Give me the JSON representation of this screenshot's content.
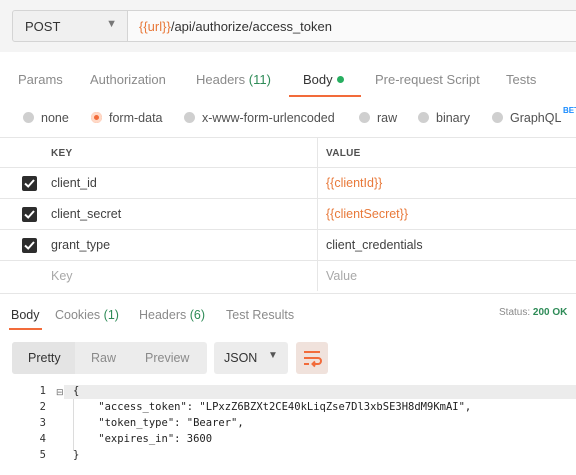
{
  "request": {
    "method": "POST",
    "url_var": "{{url}}",
    "url_path": "/api/authorize/access_token"
  },
  "tabs": {
    "params": "Params",
    "authorization": "Authorization",
    "headers": "Headers",
    "headers_count": "(11)",
    "body": "Body",
    "prerequest": "Pre-request Script",
    "tests": "Tests"
  },
  "body_types": {
    "none": "none",
    "form_data": "form-data",
    "urlencoded": "x-www-form-urlencoded",
    "raw": "raw",
    "binary": "binary",
    "graphql": "GraphQL",
    "beta": "BETA",
    "selected": "form-data"
  },
  "table": {
    "key_header": "KEY",
    "value_header": "VALUE",
    "rows": [
      {
        "key": "client_id",
        "value": "{{clientId}}",
        "checked": true
      },
      {
        "key": "client_secret",
        "value": "{{clientSecret}}",
        "checked": true
      },
      {
        "key": "grant_type",
        "value": "client_credentials",
        "checked": true
      }
    ],
    "key_placeholder": "Key",
    "value_placeholder": "Value"
  },
  "response": {
    "tabs": {
      "body": "Body",
      "cookies": "Cookies",
      "cookies_count": "(1)",
      "headers": "Headers",
      "headers_count": "(6)",
      "test_results": "Test Results"
    },
    "status_label": "Status:",
    "status_value": "200 OK",
    "view_modes": {
      "pretty": "Pretty",
      "raw": "Raw",
      "preview": "Preview"
    },
    "format": "JSON",
    "lines": [
      {
        "num": "1",
        "text": "{"
      },
      {
        "num": "2",
        "text": "    \"access_token\": \"LPxzZ6BZXt2CE40kLiqZse7Dl3xbSE3H8dM9KmAI\","
      },
      {
        "num": "3",
        "text": "    \"token_type\": \"Bearer\","
      },
      {
        "num": "4",
        "text": "    \"expires_in\": 3600"
      },
      {
        "num": "5",
        "text": "}"
      }
    ]
  },
  "colors": {
    "accent": "#f26b3a",
    "variable": "#e8793a",
    "success": "#2e8b57",
    "checkbox": "#2d2d2d"
  }
}
